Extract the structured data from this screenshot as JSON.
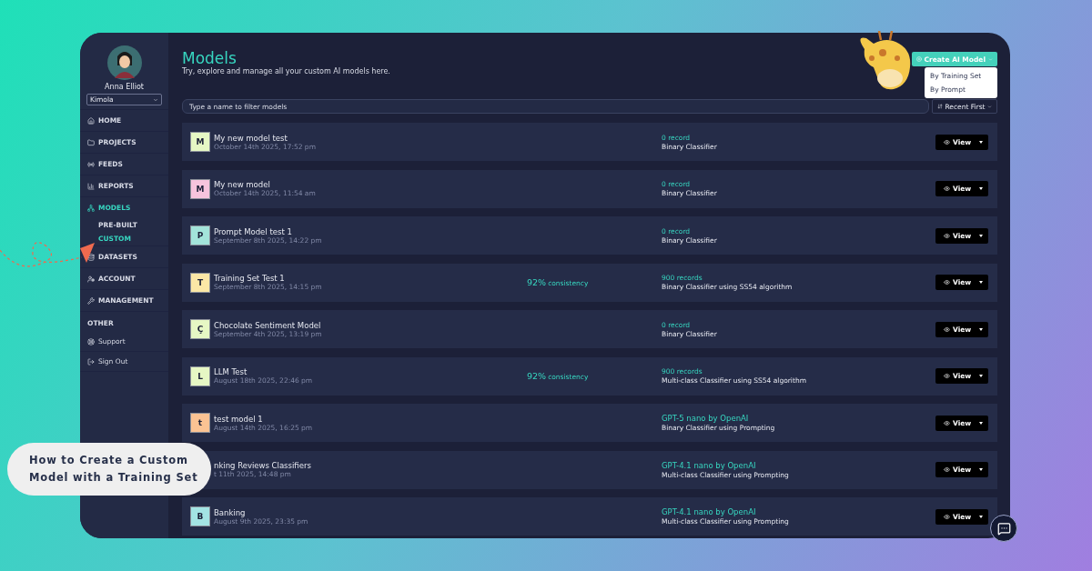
{
  "user": {
    "name": "Anna Elliot",
    "workspace": "Kimola"
  },
  "nav": [
    {
      "label": "HOME",
      "selected": false
    },
    {
      "label": "PROJECTS",
      "selected": false
    },
    {
      "label": "FEEDS",
      "selected": false
    },
    {
      "label": "REPORTS",
      "selected": false
    },
    {
      "label": "MODELS",
      "selected": true,
      "children": [
        {
          "label": "PRE-BUILT",
          "selected": false
        },
        {
          "label": "CUSTOM",
          "selected": true
        }
      ]
    },
    {
      "label": "DATASETS",
      "selected": false
    },
    {
      "label": "ACCOUNT",
      "selected": false
    },
    {
      "label": "MANAGEMENT",
      "selected": false
    }
  ],
  "other": {
    "heading": "OTHER",
    "items": [
      {
        "label": "Support"
      },
      {
        "label": "Sign Out"
      }
    ]
  },
  "header": {
    "title": "Models",
    "subtitle": "Try, explore and manage all your custom AI models here."
  },
  "create_button": {
    "label": "Create AI Model",
    "menu": [
      "By Training Set",
      "By Prompt"
    ]
  },
  "filter": {
    "placeholder": "Type a name to filter models"
  },
  "sort_button": {
    "label": "Recent First"
  },
  "models": [
    {
      "letter": "M",
      "color": "#e6f7c4",
      "name": "My new model test",
      "date": "October 14th 2025, 17:52 pm",
      "kind": "records",
      "info": "0 record",
      "type": "Binary Classifier",
      "action": "View"
    },
    {
      "letter": "M",
      "color": "#f7c4dd",
      "name": "My new model",
      "date": "October 14th 2025, 11:54 am",
      "kind": "records",
      "info": "0 record",
      "type": "Binary Classifier",
      "action": "View"
    },
    {
      "letter": "P",
      "color": "#a3e4da",
      "name": "Prompt Model test 1",
      "date": "September 8th 2025, 14:22 pm",
      "kind": "records",
      "info": "0 record",
      "type": "Binary Classifier",
      "action": "View"
    },
    {
      "letter": "T",
      "color": "#fbe7a6",
      "name": "Training Set Test 1",
      "date": "September 8th 2025, 14:15 pm",
      "consistency": "92%",
      "consistency_label": "consistency",
      "kind": "records",
      "info": "900 records",
      "type": "Binary Classifier using SS54 algorithm",
      "action": "View"
    },
    {
      "letter": "Ç",
      "color": "#e6f7c4",
      "name": "Chocolate Sentiment Model",
      "date": "September 4th 2025, 13:19 pm",
      "kind": "records",
      "info": "0 record",
      "type": "Binary Classifier",
      "action": "View"
    },
    {
      "letter": "L",
      "color": "#e6f7c4",
      "name": "LLM Test",
      "date": "August 18th 2025, 22:46 pm",
      "consistency": "92%",
      "consistency_label": "consistency",
      "kind": "records",
      "info": "900 records",
      "type": "Multi-class Classifier using SS54 algorithm",
      "action": "View"
    },
    {
      "letter": "t",
      "color": "#fbc393",
      "name": "test model 1",
      "date": "August 14th 2025, 16:25 pm",
      "kind": "model",
      "info": "GPT-5 nano by OpenAI",
      "type": "Binary Classifier using Prompting",
      "action": "View"
    },
    {
      "name": "nking Reviews Classifiers",
      "date": "t 11th 2025, 14:48 pm",
      "kind": "model",
      "info": "GPT-4.1 nano by OpenAI",
      "type": "Multi-class Classifier using Prompting",
      "action": "View"
    },
    {
      "letter": "B",
      "color": "#a3e4e4",
      "name": "Banking",
      "date": "August 9th 2025, 23:35 pm",
      "kind": "model",
      "info": "GPT-4.1 nano by OpenAI",
      "type": "Multi-class Classifier using Prompting",
      "action": "View"
    }
  ],
  "callout": "How to Create a Custom Model with a Training Set"
}
